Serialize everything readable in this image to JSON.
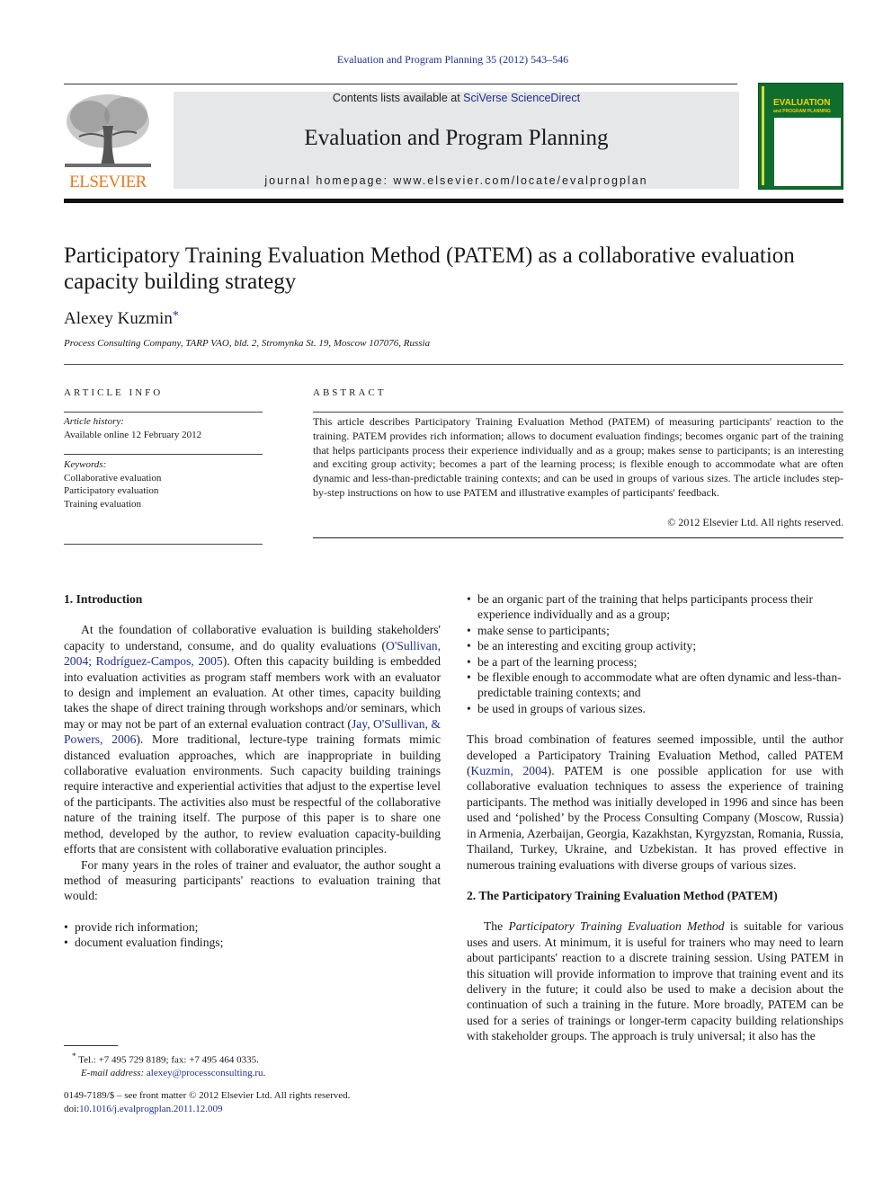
{
  "header": {
    "citation": "Evaluation and Program Planning 35 (2012) 543–546",
    "contents_prefix": "Contents lists available at ",
    "contents_link": "SciVerse ScienceDirect",
    "journal_title": "Evaluation and Program Planning",
    "homepage": "journal homepage: www.elsevier.com/locate/evalprogplan",
    "publisher_logo_text": "ELSEVIER",
    "cover_title": "EVALUATION",
    "cover_subtitle": "and PROGRAM PLANNING"
  },
  "article": {
    "title": "Participatory Training Evaluation Method (PATEM) as a collaborative evaluation capacity building strategy",
    "author": "Alexey Kuzmin",
    "author_marker": "*",
    "affiliation": "Process Consulting Company, TARP VAO, bld. 2, Stromynka St. 19, Moscow 107076, Russia"
  },
  "article_info": {
    "label": "ARTICLE INFO",
    "history_label": "Article history:",
    "history_value": "Available online 12 February 2012",
    "keywords_label": "Keywords:",
    "keywords": [
      "Collaborative evaluation",
      "Participatory evaluation",
      "Training evaluation"
    ]
  },
  "abstract": {
    "label": "ABSTRACT",
    "text": "This article describes Participatory Training Evaluation Method (PATEM) of measuring participants' reaction to the training. PATEM provides rich information; allows to document evaluation findings; becomes organic part of the training that helps participants process their experience individually and as a group; makes sense to participants; is an interesting and exciting group activity; becomes a part of the learning process; is flexible enough to accommodate what are often dynamic and less-than-predictable training contexts; and can be used in groups of various sizes. The article includes step-by-step instructions on how to use PATEM and illustrative examples of participants' feedback.",
    "copyright": "© 2012 Elsevier Ltd. All rights reserved."
  },
  "intro": {
    "heading": "1. Introduction",
    "p1_a": "At the foundation of collaborative evaluation is building stakeholders' capacity to understand, consume, and do quality evaluations (",
    "p1_ref1": "O'Sullivan, 2004; Rodríguez-Campos, 2005",
    "p1_b": "). Often this capacity building is embedded into evaluation activities as program staff members work with an evaluator to design and implement an evaluation. At other times, capacity building takes the shape of direct training through workshops and/or seminars, which may or may not be part of an external evaluation contract (",
    "p1_ref2": "Jay, O'Sullivan, & Powers, 2006",
    "p1_c": "). More traditional, lecture-type training formats mimic distanced evaluation approaches, which are inappropriate in building collaborative evaluation environments. Such capacity building trainings require interactive and experiential activities that adjust to the expertise level of the participants. The activities also must be respectful of the collaborative nature of the training itself. The purpose of this paper is to share one method, developed by the author, to review evaluation capacity-building efforts that are consistent with collaborative evaluation principles.",
    "p2": "For many years in the roles of trainer and evaluator, the author sought a method of measuring participants' reactions to evaluation training that would:",
    "bullets_left": [
      "provide rich information;",
      "document evaluation findings;"
    ],
    "bullets_right": [
      "be an organic part of the training that helps participants process their experience individually and as a group;",
      "make sense to participants;",
      "be an interesting and exciting group activity;",
      "be a part of the learning process;",
      "be flexible enough to accommodate what are often dynamic and less-than-predictable training contexts; and",
      "be used in groups of various sizes."
    ],
    "p3_a": "This broad combination of features seemed impossible, until the author developed a Participatory Training Evaluation Method, called PATEM (",
    "p3_ref": "Kuzmin, 2004",
    "p3_b": "). PATEM is one possible application for use with collaborative evaluation techniques to assess the experience of training participants. The method was initially developed in 1996 and since has been used and ‘polished’ by the Process Consulting Company (Moscow, Russia) in Armenia, Azerbaijan, Georgia, Kazakhstan, Kyrgyzstan, Romania, Russia, Thailand, Turkey, Ukraine, and Uzbekistan. It has proved effective in numerous training evaluations with diverse groups of various sizes."
  },
  "section2": {
    "heading": "2. The Participatory Training Evaluation Method (PATEM)",
    "p1_a": "The ",
    "p1_em": "Participatory Training Evaluation Method",
    "p1_b": " is suitable for various uses and users. At minimum, it is useful for trainers who may need to learn about participants' reaction to a discrete training session. Using PATEM in this situation will provide information to improve that training event and its delivery in the future; it could also be used to make a decision about the continuation of such a training in the future. More broadly, PATEM can be used for a series of trainings or longer-term capacity building relationships with stakeholder groups. The approach is truly universal; it also has the"
  },
  "footnote": {
    "marker": "*",
    "contact": "Tel.: +7 495 729 8189; fax: +7 495 464 0335.",
    "email_label": "E-mail address: ",
    "email": "alexey@processconsulting.ru",
    "email_suffix": "."
  },
  "front_matter": {
    "issn_line": "0149-7189/$ – see front matter © 2012 Elsevier Ltd. All rights reserved.",
    "doi_label": "doi:",
    "doi": "10.1016/j.evalprogplan.2011.12.009"
  },
  "colors": {
    "link": "#1f2f8f",
    "elsevier_orange": "#e8781d",
    "masthead_gray": "#e6e7e8",
    "cover_green": "#0f6e2e",
    "cover_yellow": "#f2d10b"
  }
}
